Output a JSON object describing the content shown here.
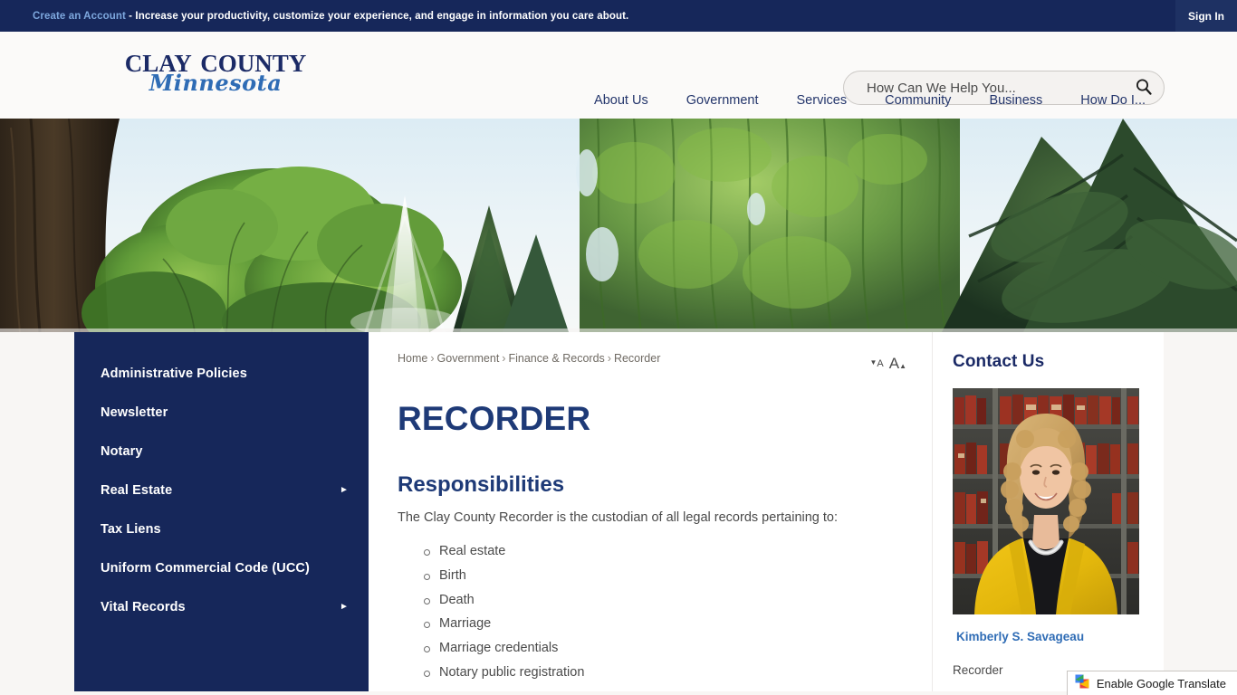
{
  "topbar": {
    "account_link": "Create an Account",
    "message": " - Increase your productivity, customize your experience, and engage in information you care about.",
    "signin_label": "Sign In"
  },
  "header": {
    "logo_main": "Clay County",
    "logo_sub": "Minnesota",
    "search": {
      "placeholder": "How Can We Help You...",
      "value": "",
      "icon": "search-icon"
    },
    "nav": [
      {
        "label": "About Us"
      },
      {
        "label": "Government"
      },
      {
        "label": "Services"
      },
      {
        "label": "Community"
      },
      {
        "label": "Business"
      },
      {
        "label": "How Do I..."
      }
    ]
  },
  "banner": {
    "alt": "Park scene with trees and a water fountain"
  },
  "sidebar": {
    "items": [
      {
        "label": "Administrative Policies",
        "has_submenu": false,
        "arrow": ""
      },
      {
        "label": "Newsletter",
        "has_submenu": false,
        "arrow": ""
      },
      {
        "label": "Notary",
        "has_submenu": false,
        "arrow": ""
      },
      {
        "label": "Real Estate",
        "has_submenu": true,
        "arrow": "►"
      },
      {
        "label": "Tax Liens",
        "has_submenu": false,
        "arrow": ""
      },
      {
        "label": "Uniform Commercial Code (UCC)",
        "has_submenu": false,
        "arrow": ""
      },
      {
        "label": "Vital Records",
        "has_submenu": true,
        "arrow": "►"
      }
    ]
  },
  "main": {
    "breadcrumb": [
      {
        "label": "Home"
      },
      {
        "label": "Government"
      },
      {
        "label": "Finance & Records"
      },
      {
        "label": "Recorder"
      }
    ],
    "breadcrumb_separator": "›",
    "font_size": {
      "decrease_label": "A",
      "decrease_arrow": "▼",
      "increase_label": "A",
      "increase_arrow": "▲"
    },
    "page_title": "RECORDER",
    "section_title": "Responsibilities",
    "intro": "The Clay County Recorder is the custodian of all legal records pertaining to:",
    "responsibilities": [
      "Real estate",
      "Birth",
      "Death",
      "Marriage",
      "Marriage credentials",
      "Notary public registration"
    ]
  },
  "contact": {
    "heading": "Contact Us",
    "photo_alt": "Portrait of the Clay County Recorder",
    "name": "Kimberly S. Savageau",
    "role": "Recorder"
  },
  "translate": {
    "label": "Enable Google Translate",
    "icon": "google-translate-icon"
  },
  "colors": {
    "navy": "#16275a",
    "navy_sign_in": "#1e3163",
    "link_blue": "#2f6cb5",
    "heading_blue": "#1e3a77",
    "page_bg": "#f8f6f4",
    "card_bg": "#ffffff"
  }
}
